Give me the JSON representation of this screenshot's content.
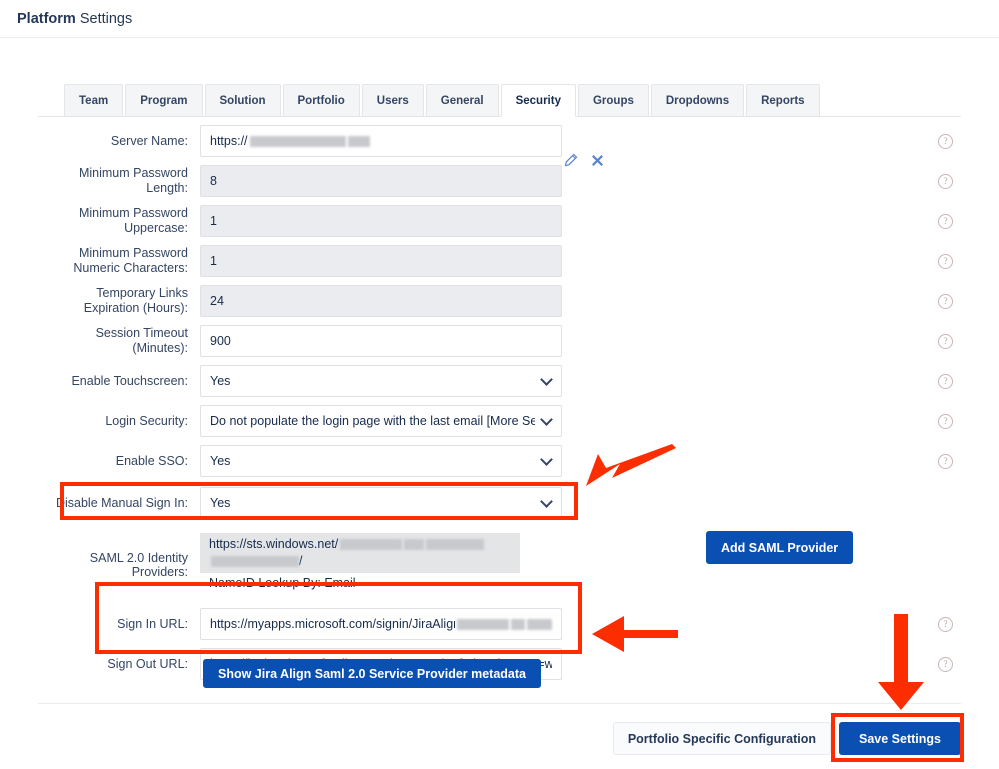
{
  "header": {
    "title_strong": "Platform",
    "title_rest": " Settings"
  },
  "tabs": [
    {
      "label": "Team",
      "active": false
    },
    {
      "label": "Program",
      "active": false
    },
    {
      "label": "Solution",
      "active": false
    },
    {
      "label": "Portfolio",
      "active": false
    },
    {
      "label": "Users",
      "active": false
    },
    {
      "label": "General",
      "active": false
    },
    {
      "label": "Security",
      "active": true
    },
    {
      "label": "Groups",
      "active": false
    },
    {
      "label": "Dropdowns",
      "active": false
    },
    {
      "label": "Reports",
      "active": false
    }
  ],
  "form": {
    "server_name": {
      "label": "Server Name:",
      "value": "https://",
      "redacted": true
    },
    "min_password_length": {
      "label": "Minimum Password Length:",
      "value": "8"
    },
    "min_password_uppercase": {
      "label": "Minimum Password Uppercase:",
      "value": "1"
    },
    "min_password_numeric": {
      "label": "Minimum Password Numeric Characters:",
      "value": "1"
    },
    "temp_links_expiration": {
      "label": "Temporary Links Expiration (Hours):",
      "value": "24"
    },
    "session_timeout": {
      "label": "Session Timeout (Minutes):",
      "value": "900"
    },
    "enable_touchscreen": {
      "label": "Enable Touchscreen:",
      "value": "Yes"
    },
    "login_security": {
      "label": "Login Security:",
      "value": "Do not populate the login page with the last email [More Secure]"
    },
    "enable_sso": {
      "label": "Enable SSO:",
      "value": "Yes"
    },
    "disable_manual_signin": {
      "label": "Disable Manual Sign In:",
      "value": "Yes"
    },
    "saml_providers": {
      "label": "SAML 2.0 Identity Providers:",
      "url_prefix": "https://sts.windows.net/",
      "url_suffix": "/",
      "nameid": "NameID Lookup By: Email"
    },
    "sign_in_url": {
      "label": "Sign In URL:",
      "value": "https://myapps.microsoft.com/signin/JiraAlign/"
    },
    "sign_out_url": {
      "label": "Sign Out URL:",
      "value": "https://login.microsoftonline.com/common/wsfederation?wa=wsigno"
    }
  },
  "buttons": {
    "add_saml": "Add SAML Provider",
    "show_metadata": "Show Jira Align Saml 2.0 Service Provider metadata",
    "portfolio_config": "Portfolio Specific Configuration",
    "save_settings": "Save Settings"
  },
  "icons": {
    "help": "?",
    "edit": "edit-pencil-icon",
    "delete": "delete-x-icon"
  },
  "colors": {
    "accent_blue": "#0a50b2",
    "annotation_red": "#fc2d00",
    "text": "#172b4d",
    "readonly_bg": "#ebecf0"
  }
}
